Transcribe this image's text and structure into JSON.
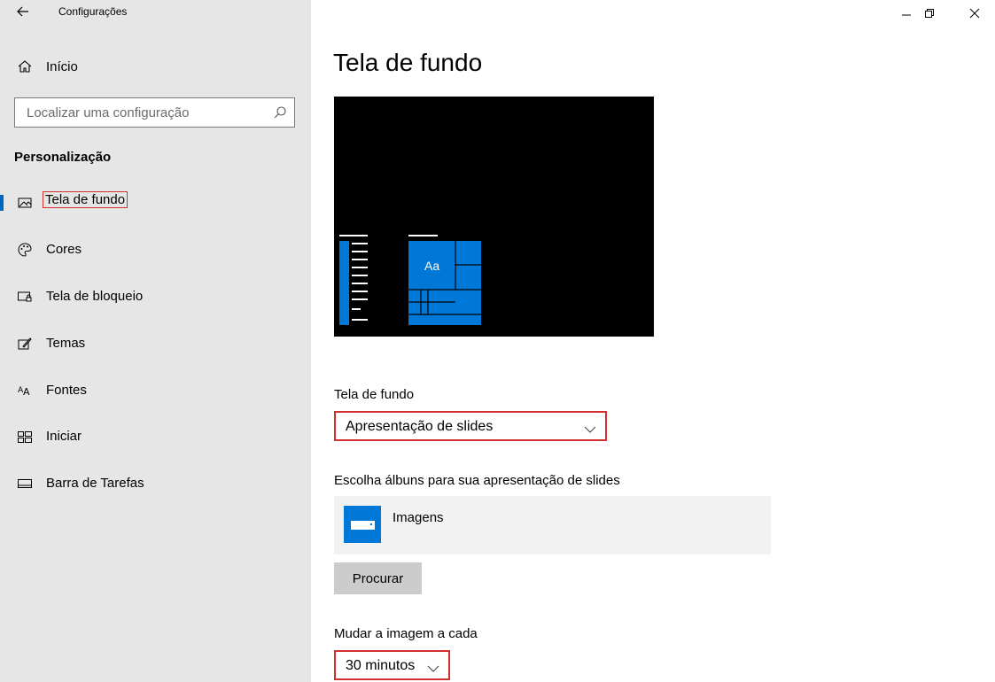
{
  "window": {
    "title": "Configurações",
    "controls": [
      "minimize",
      "restore",
      "close"
    ]
  },
  "sidebar": {
    "home_label": "Início",
    "search_placeholder": "Localizar uma configuração",
    "section_title": "Personalização",
    "items": [
      {
        "label": "Tela de fundo",
        "icon": "picture-icon",
        "selected": true
      },
      {
        "label": "Cores",
        "icon": "palette-icon",
        "selected": false
      },
      {
        "label": "Tela de bloqueio",
        "icon": "lock-screen-icon",
        "selected": false
      },
      {
        "label": "Temas",
        "icon": "themes-icon",
        "selected": false
      },
      {
        "label": "Fontes",
        "icon": "fonts-icon",
        "selected": false
      },
      {
        "label": "Iniciar",
        "icon": "start-icon",
        "selected": false
      },
      {
        "label": "Barra de Tarefas",
        "icon": "taskbar-icon",
        "selected": false
      }
    ]
  },
  "main": {
    "title": "Tela de fundo",
    "preview_tile_label": "Aa",
    "background_label": "Tela de fundo",
    "background_value": "Apresentação de slides",
    "albums_label": "Escolha álbuns para sua apresentação de slides",
    "album_name": "Imagens",
    "browse_button": "Procurar",
    "interval_label": "Mudar a imagem a cada",
    "interval_value": "30 minutos"
  },
  "colors": {
    "accent": "#0078d7",
    "highlight": "#d32f2f",
    "sidebar_bg": "#e6e6e6"
  }
}
